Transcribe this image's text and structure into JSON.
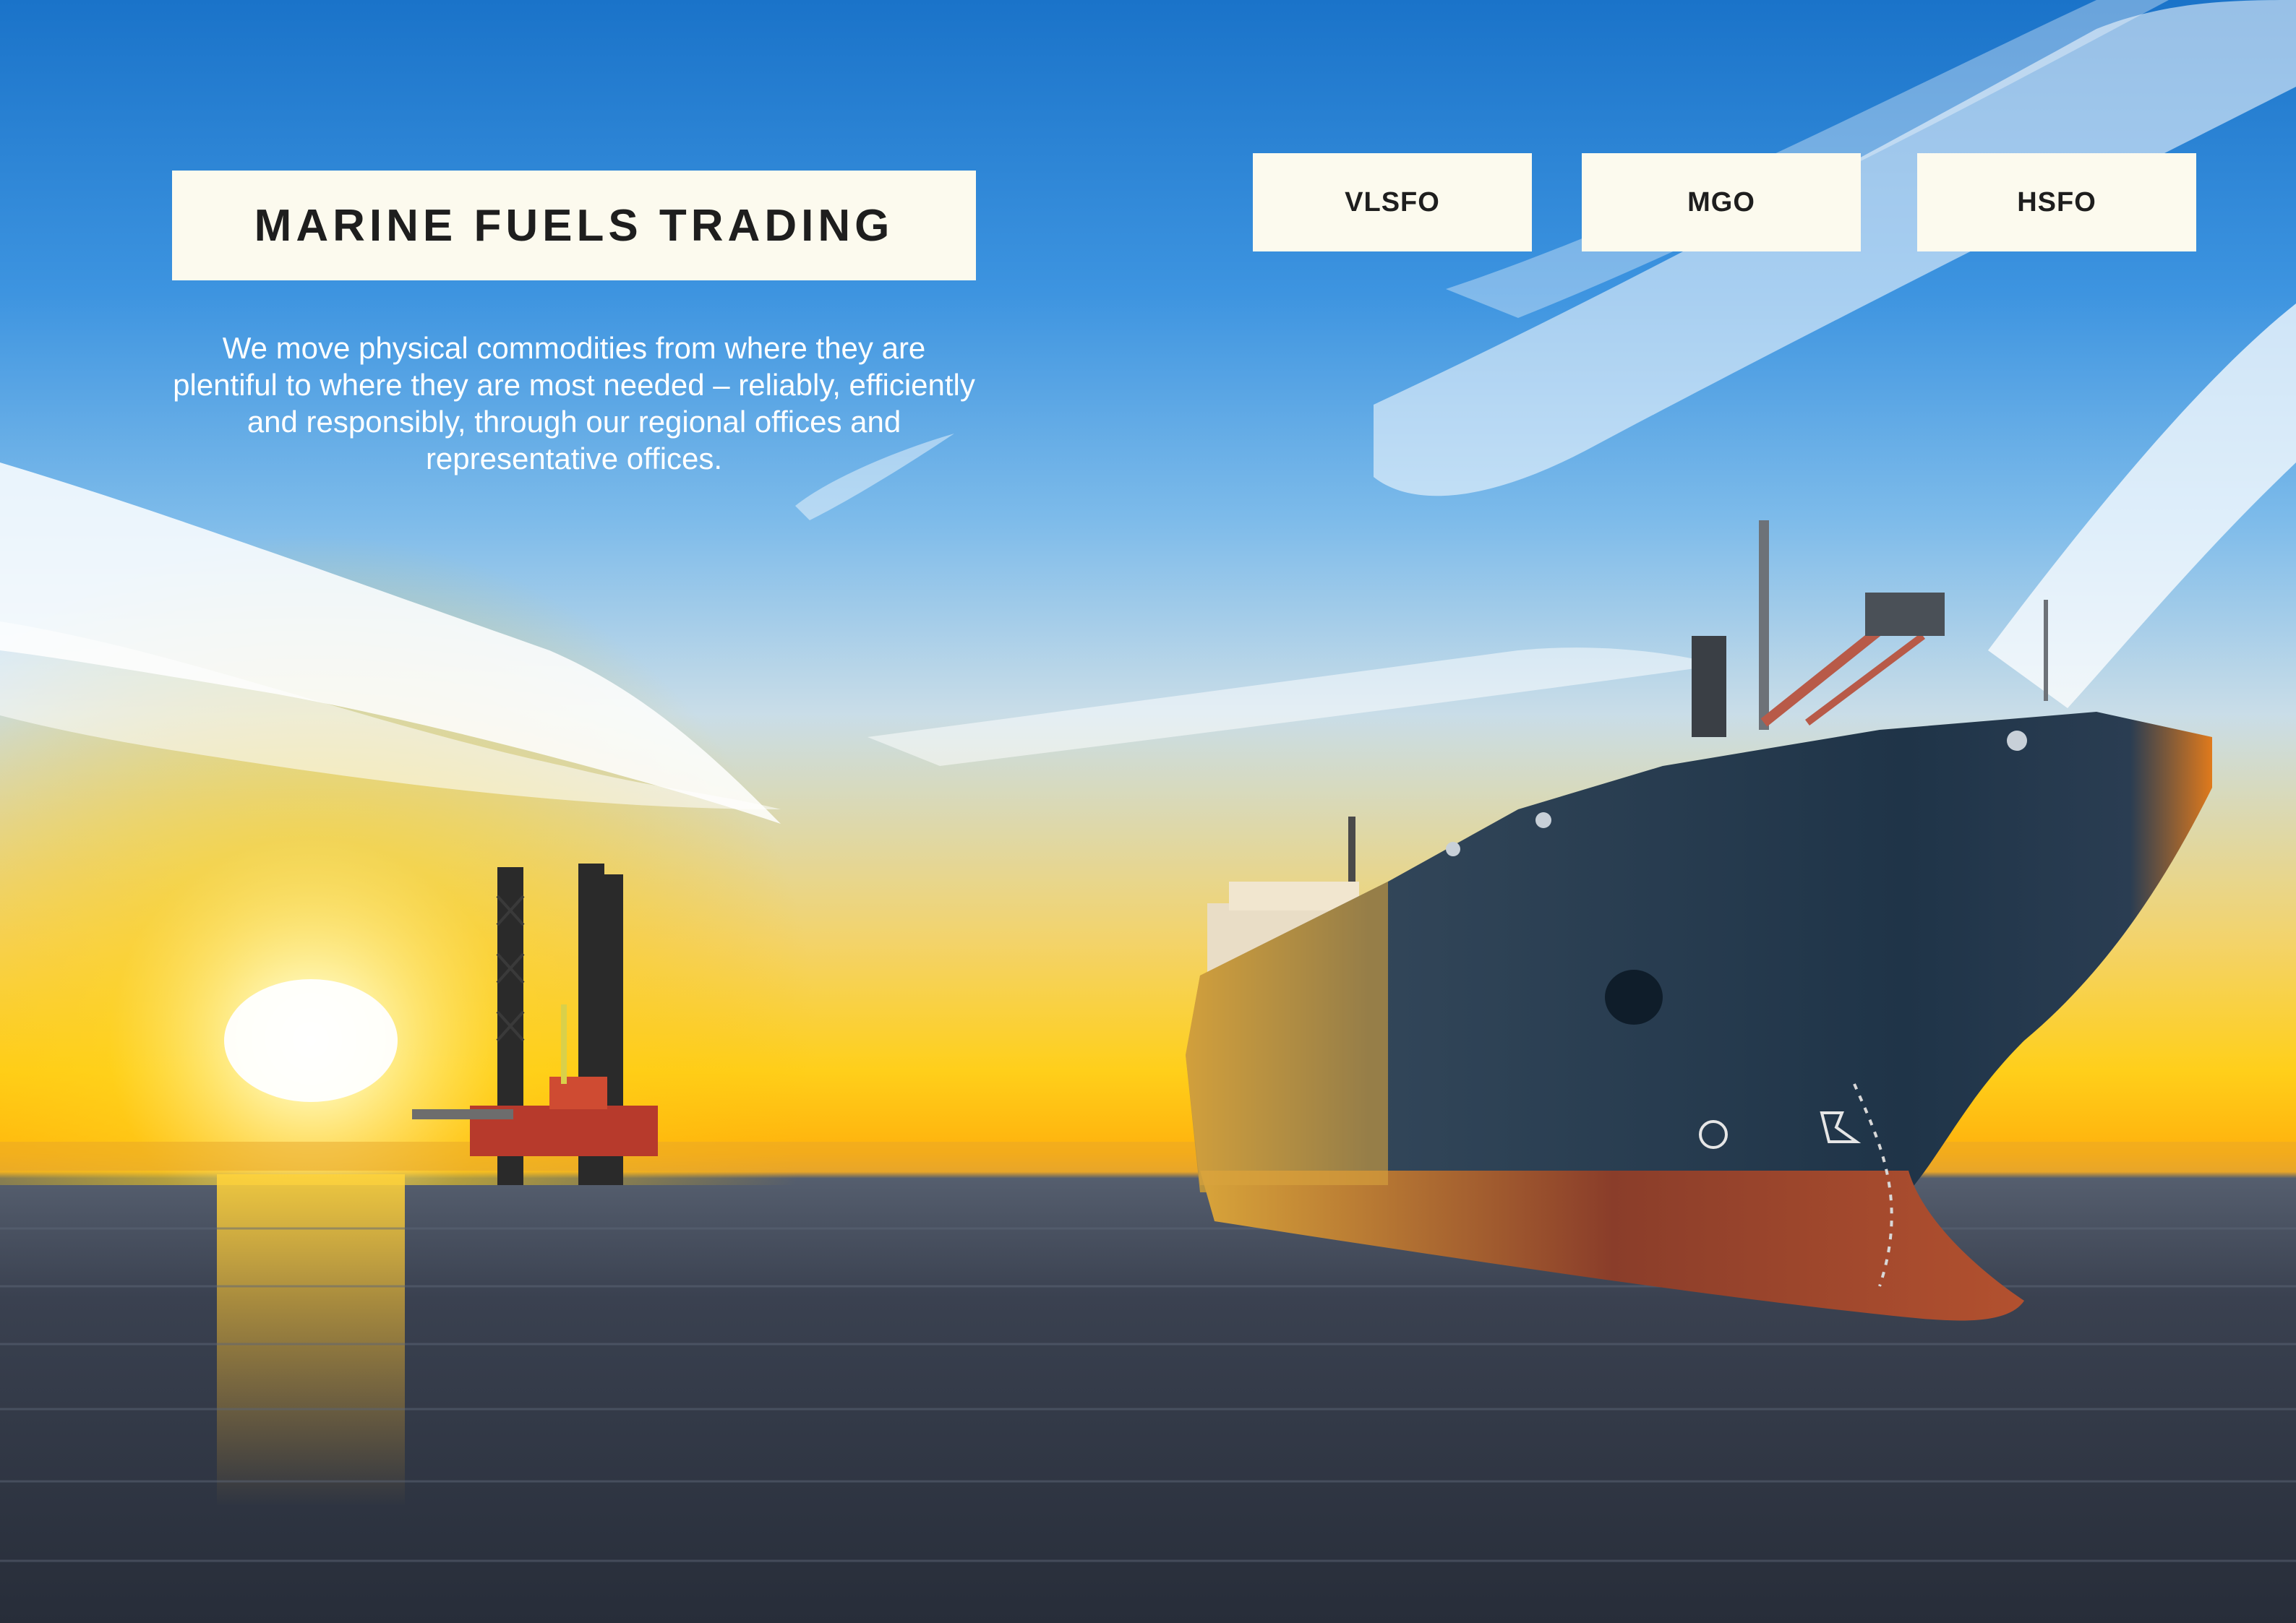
{
  "header": {
    "title": "MARINE FUELS TRADING",
    "tagline": "We move physical commodities from where they are plentiful to where they are most needed – reliably, efficiently and responsibly, through our regional offices and representative offices."
  },
  "fuel_nav": {
    "items": [
      {
        "label": "VLSFO"
      },
      {
        "label": "MGO"
      },
      {
        "label": "HSFO"
      }
    ]
  },
  "hero": {
    "image": "ocean-sunset-tanker-ship-and-oil-rig"
  },
  "colors": {
    "box_background": "#fcfaee",
    "text_dark": "#1e1e1e",
    "sky_blue": "#1a73c9",
    "sunset_yellow": "#ffcf1a",
    "sea_dark": "#272d39",
    "hull_navy": "#1f3448",
    "hull_red": "#a4432a"
  }
}
